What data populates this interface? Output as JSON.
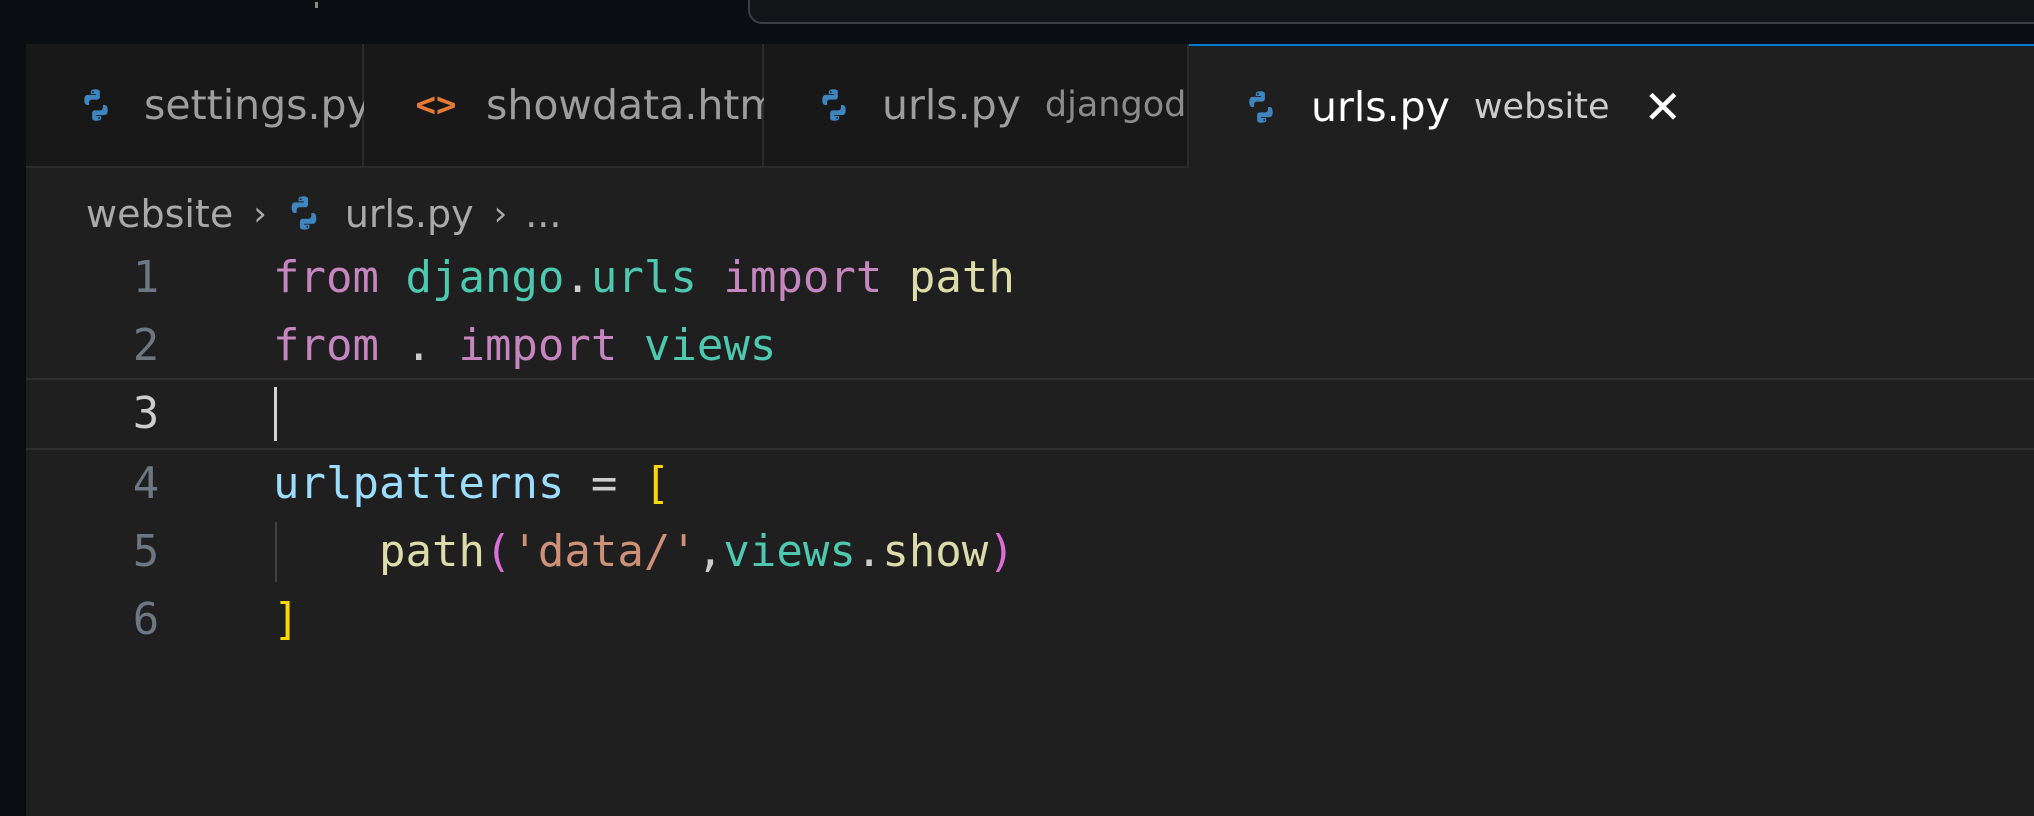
{
  "tabs": [
    {
      "label": "settings.py",
      "description": "",
      "icon": "python-icon",
      "active": false
    },
    {
      "label": "showdata.html",
      "description": "",
      "icon": "html-code-icon",
      "active": false
    },
    {
      "label": "urls.py",
      "description": "djangodb",
      "icon": "python-icon",
      "active": false
    },
    {
      "label": "urls.py",
      "description": "website",
      "icon": "python-icon",
      "active": true
    }
  ],
  "tab_close_glyph": "✕",
  "html_icon_glyph": "<>",
  "breadcrumb": {
    "folder": "website",
    "file": "urls.py",
    "more": "..."
  },
  "breadcrumb_separator": "›",
  "editor": {
    "current_line": 3,
    "lines": [
      {
        "number": "1",
        "tokens": [
          "from",
          " ",
          "django",
          ".",
          "urls",
          " ",
          "import",
          " ",
          "path"
        ]
      },
      {
        "number": "2",
        "tokens": [
          "from",
          " . ",
          "import",
          " ",
          "views"
        ]
      },
      {
        "number": "3",
        "tokens": []
      },
      {
        "number": "4",
        "tokens": [
          "urlpatterns",
          " = ",
          "["
        ]
      },
      {
        "number": "5",
        "tokens": [
          "    ",
          "path",
          "(",
          "'data/'",
          ",",
          "views",
          ".",
          "show",
          ")"
        ]
      },
      {
        "number": "6",
        "tokens": [
          "]"
        ]
      }
    ]
  },
  "colors": {
    "keyword": "#c586c0",
    "module": "#4ec9b0",
    "function": "#dcdcaa",
    "variable": "#9cdcfe",
    "string": "#ce9178",
    "bracket_level1": "#ffd700",
    "bracket_level2": "#da70d6",
    "python_icon": "#3f86c0",
    "html_icon": "#e37933",
    "active_tab_accent": "#0078d4"
  }
}
